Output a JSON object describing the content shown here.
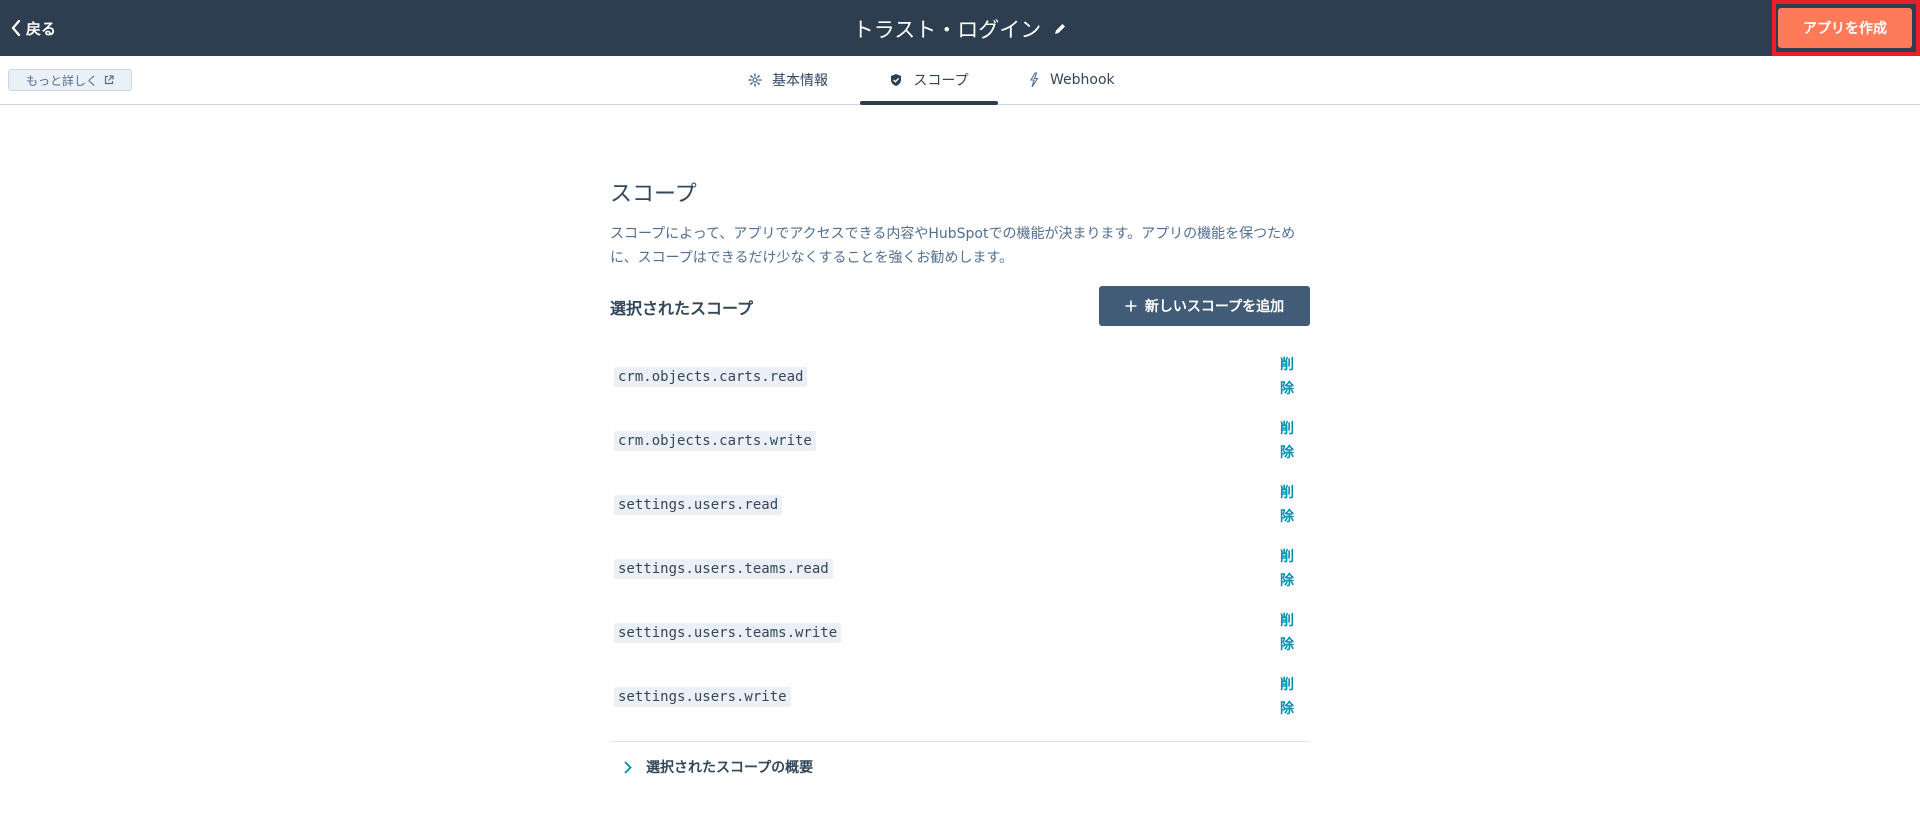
{
  "header": {
    "back_label": "戻る",
    "title": "トラスト・ログイン",
    "create_app_label": "アプリを作成"
  },
  "subnav": {
    "more_label": "もっと詳しく",
    "tabs": [
      {
        "label": "基本情報",
        "icon": "gear-icon"
      },
      {
        "label": "スコープ",
        "icon": "shield-check-icon",
        "active": true
      },
      {
        "label": "Webhook",
        "icon": "webhook-icon"
      }
    ]
  },
  "main": {
    "heading": "スコープ",
    "description": "スコープによって、アプリでアクセスできる内容やHubSpotでの機能が決まります。アプリの機能を保つために、スコープはできるだけ少なくすることを強くお勧めします。",
    "selected_label": "選択されたスコープ",
    "add_button_label": "新しいスコープを追加",
    "delete_label": "削除",
    "scopes": [
      "crm.objects.carts.read",
      "crm.objects.carts.write",
      "settings.users.read",
      "settings.users.teams.read",
      "settings.users.teams.write",
      "settings.users.write"
    ],
    "summary_label": "選択されたスコープの概要"
  },
  "colors": {
    "header_bg": "#2d3e50",
    "accent_orange": "#ff7a59",
    "highlight_red": "#e8202a",
    "link": "#0091ae",
    "add_button_bg": "#425b76"
  }
}
